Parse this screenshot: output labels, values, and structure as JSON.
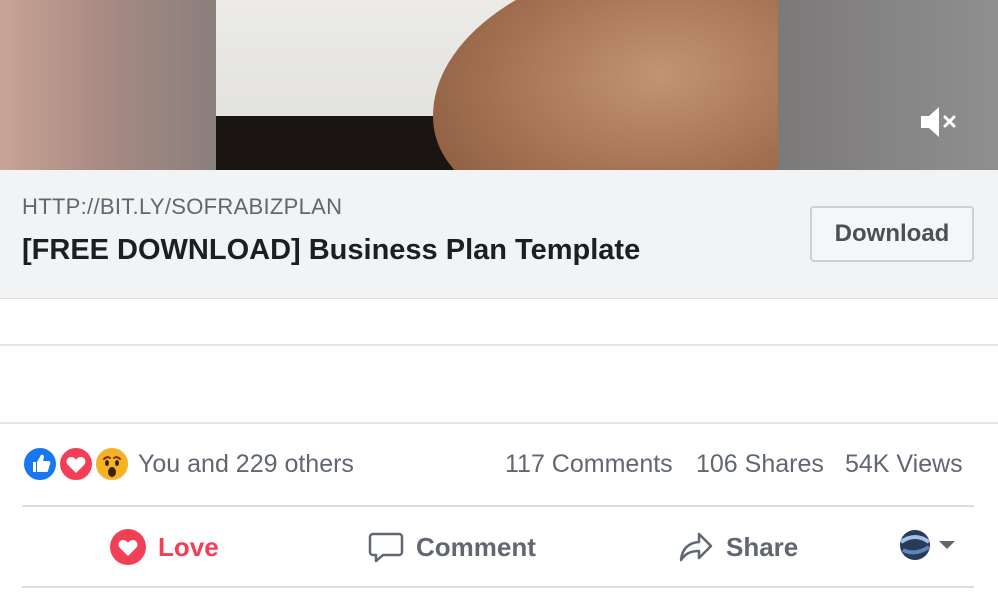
{
  "link_card": {
    "url": "HTTP://BIT.LY/SOFRABIZPLAN",
    "title": "[FREE DOWNLOAD] Business Plan Template",
    "download_label": "Download"
  },
  "stats": {
    "reactions_text": "You and 229 others",
    "comments": "117 Comments",
    "shares": "106 Shares",
    "views": "54K Views"
  },
  "actions": {
    "love": "Love",
    "comment": "Comment",
    "share": "Share"
  },
  "icons": {
    "mute": "speaker-muted-icon",
    "like": "like-reaction-icon",
    "love": "love-reaction-icon",
    "wow": "wow-reaction-icon",
    "love_action": "heart-icon",
    "comment_action": "speech-bubble-icon",
    "share_action": "share-arrow-icon",
    "audience": "page-avatar-icon",
    "dropdown": "caret-down-icon"
  },
  "colors": {
    "love_red": "#f33e58",
    "like_blue": "#1877f2",
    "text_gray": "#606770",
    "card_bg": "#f2f3f5"
  }
}
